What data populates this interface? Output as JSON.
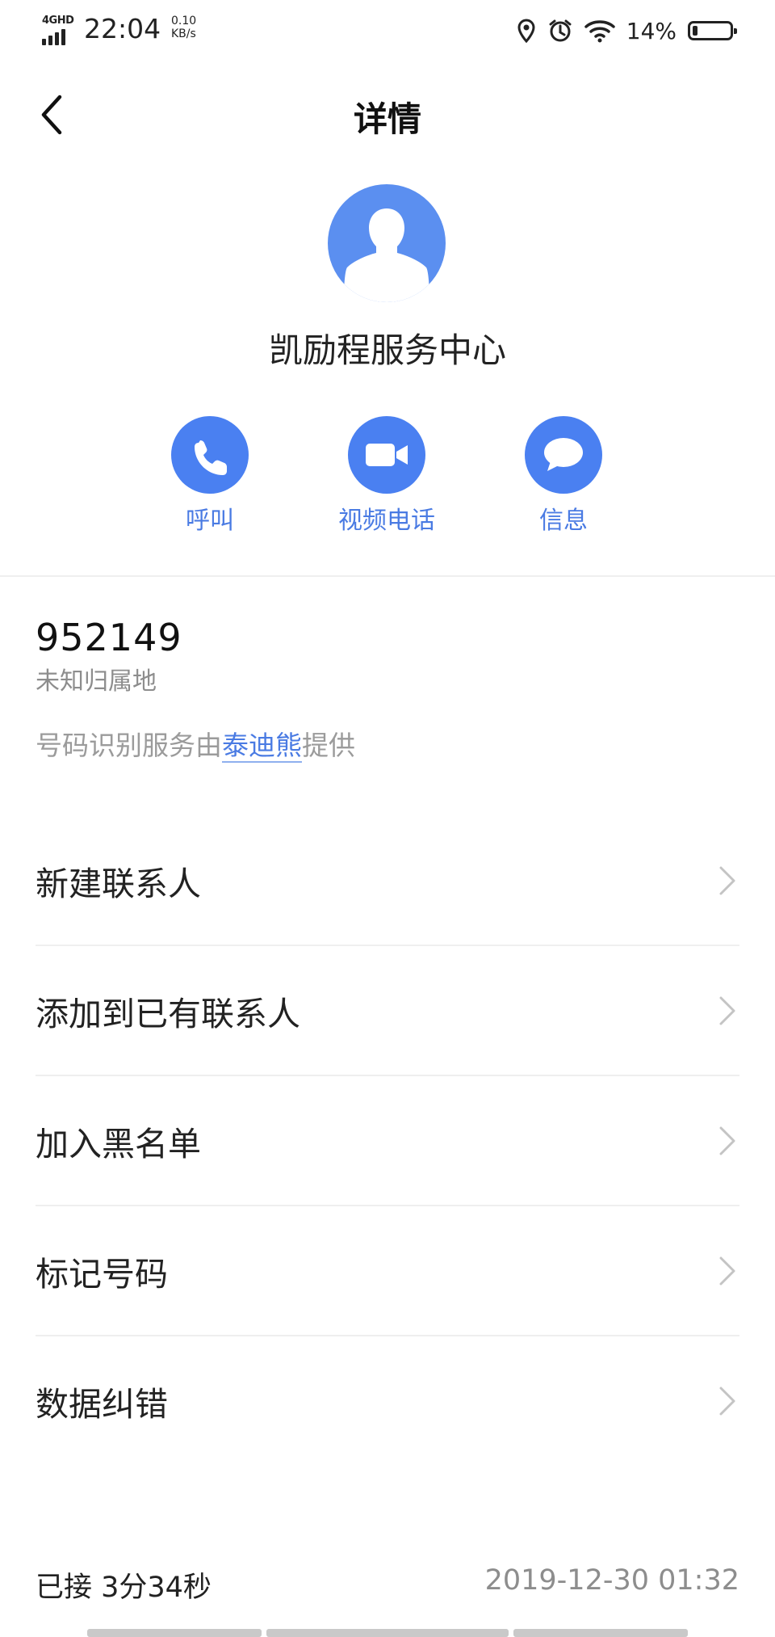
{
  "status_bar": {
    "network": "4GHD",
    "time": "22:04",
    "speed_value": "0.10",
    "speed_unit": "KB/s",
    "battery_percent": "14%",
    "icons": [
      "location-icon",
      "alarm-icon",
      "wifi-icon",
      "battery-icon"
    ]
  },
  "header": {
    "title": "详情",
    "back_icon": "chevron-left-icon"
  },
  "contact": {
    "name": "凯励程服务中心",
    "avatar_color": "#5b8ff0"
  },
  "actions": [
    {
      "label": "呼叫",
      "icon": "phone-icon"
    },
    {
      "label": "视频电话",
      "icon": "video-camera-icon"
    },
    {
      "label": "信息",
      "icon": "message-bubble-icon"
    }
  ],
  "number_info": {
    "number": "952149",
    "location": "未知归属地",
    "provider_prefix": "号码识别服务由",
    "provider_name": "泰迪熊",
    "provider_suffix": "提供"
  },
  "menu": [
    {
      "label": "新建联系人"
    },
    {
      "label": "添加到已有联系人"
    },
    {
      "label": "加入黑名单"
    },
    {
      "label": "标记号码"
    },
    {
      "label": "数据纠错"
    }
  ],
  "footer": {
    "call_status": "已接 3分34秒",
    "datetime": "2019-12-30 01:32"
  },
  "colors": {
    "accent": "#4a80f1",
    "link": "#4a7be3",
    "secondary_text": "#8d8d8d"
  }
}
